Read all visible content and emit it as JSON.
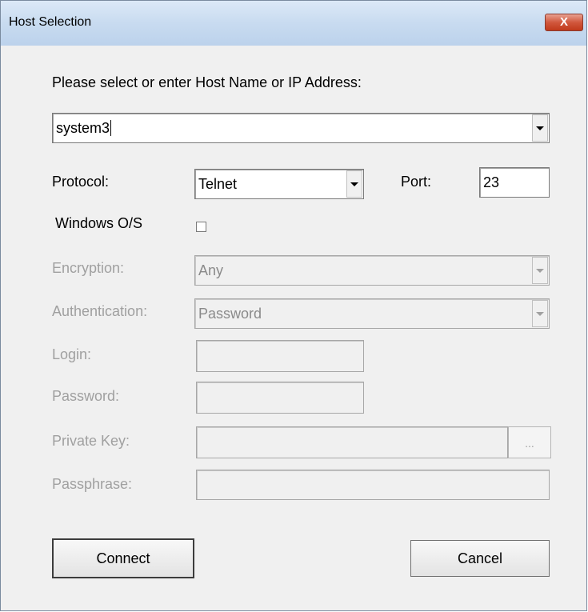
{
  "window": {
    "title": "Host Selection",
    "close_icon": "close-icon",
    "close_glyph": "X"
  },
  "host": {
    "prompt": "Please select or enter Host Name or IP Address:",
    "value": "system3"
  },
  "protocol": {
    "label": "Protocol:",
    "value": "Telnet"
  },
  "port": {
    "label": "Port:",
    "value": "23"
  },
  "windows_os": {
    "label": "Windows O/S",
    "checked": false
  },
  "encryption": {
    "label": "Encryption:",
    "value": "Any"
  },
  "authentication": {
    "label": "Authentication:",
    "value": "Password"
  },
  "login": {
    "label": "Login:",
    "value": ""
  },
  "password": {
    "label": "Password:",
    "value": ""
  },
  "private_key": {
    "label": "Private Key:",
    "value": "",
    "browse_label": "..."
  },
  "passphrase": {
    "label": "Passphrase:",
    "value": ""
  },
  "buttons": {
    "connect": "Connect",
    "cancel": "Cancel"
  },
  "colors": {
    "titlebar": "#c8dbf0",
    "close": "#c0391b",
    "disabled_text": "#a0a0a0"
  }
}
